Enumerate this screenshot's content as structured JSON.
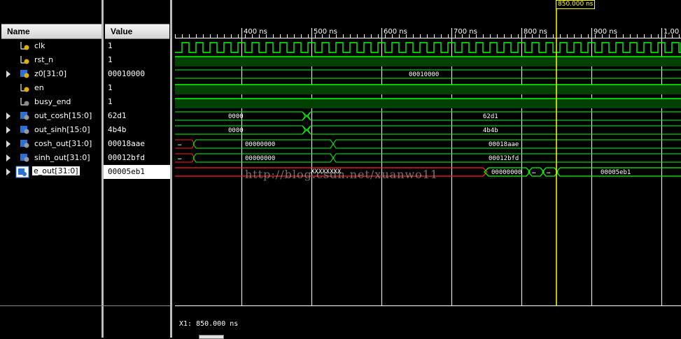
{
  "columns": {
    "name": "Name",
    "value": "Value"
  },
  "signals": [
    {
      "name": "clk",
      "value": "1",
      "kind": "bit",
      "expandable": false
    },
    {
      "name": "rst_n",
      "value": "1",
      "kind": "bit",
      "expandable": false
    },
    {
      "name": "z0[31:0]",
      "value": "00010000",
      "kind": "bus",
      "expandable": true
    },
    {
      "name": "en",
      "value": "1",
      "kind": "bit",
      "expandable": false
    },
    {
      "name": "busy_end",
      "value": "1",
      "kind": "bit",
      "expandable": false
    },
    {
      "name": "out_cosh[15:0]",
      "value": "62d1",
      "kind": "bus",
      "expandable": true
    },
    {
      "name": "out_sinh[15:0]",
      "value": "4b4b",
      "kind": "bus",
      "expandable": true
    },
    {
      "name": "cosh_out[31:0]",
      "value": "00018aae",
      "kind": "bus",
      "expandable": true
    },
    {
      "name": "sinh_out[31:0]",
      "value": "00012bfd",
      "kind": "bus",
      "expandable": true
    },
    {
      "name": "e_out[31:0]",
      "value": "00005eb1",
      "kind": "bus",
      "expandable": true,
      "selected": true
    }
  ],
  "timeline": {
    "ticks": [
      "400 ns",
      "500 ns",
      "600 ns",
      "700 ns",
      "800 ns",
      "900 ns",
      "1,00"
    ],
    "cursor_label": "850.000 ns",
    "status": "X1: 850.000 ns"
  },
  "wave_labels": {
    "z0": "00010000",
    "out_cosh_a": "0000",
    "out_cosh_b": "62d1",
    "out_sinh_a": "0000",
    "out_sinh_b": "4b4b",
    "cosh_a": "…",
    "cosh_b": "00000000",
    "cosh_c": "00018aae",
    "sinh_a": "…",
    "sinh_b": "00000000",
    "sinh_c": "00012bfd",
    "e_x": "XXXXXXXX",
    "e_b": "00000000",
    "e_c": "…",
    "e_d": "…",
    "e_e": "00005eb1"
  },
  "watermark": "http://blog.csdn.net/xuanwo11",
  "colors": {
    "wave": "#00ff00",
    "bus_fill": "#004000",
    "error": "#ff2020",
    "cursor": "#ffff00",
    "grid": "#ffffff"
  }
}
